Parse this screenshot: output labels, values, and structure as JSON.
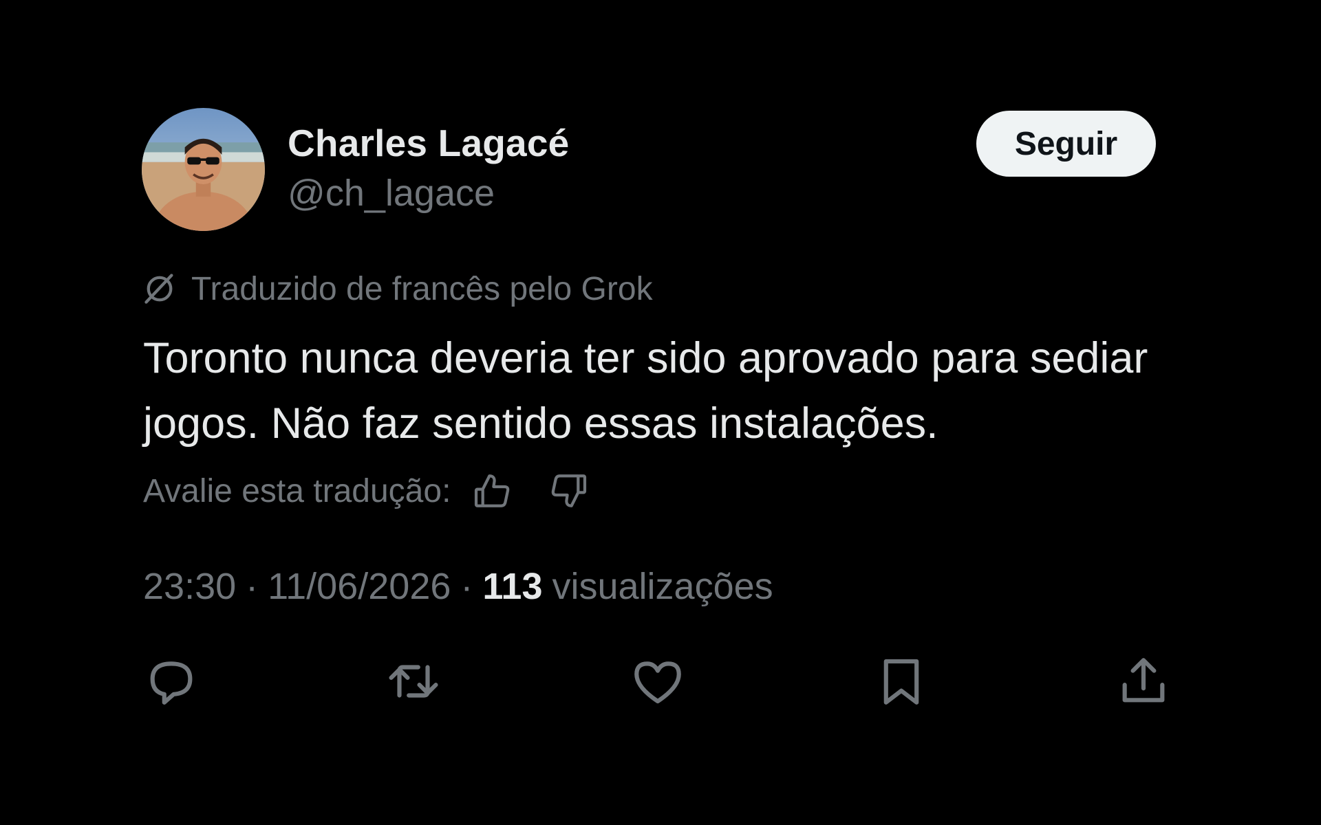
{
  "author": {
    "display_name": "Charles Lagacé",
    "handle": "@ch_lagace",
    "avatar_icon": "profile-photo-beach"
  },
  "follow_button": {
    "label": "Seguir"
  },
  "translation": {
    "icon": "grok-icon",
    "notice": "Traduzido de francês pelo Grok",
    "rate_label": "Avalie esta tradução:"
  },
  "tweet": {
    "text": "Toronto nunca deveria ter sido aprovado para sediar jogos. Não faz sentido essas instalações."
  },
  "meta": {
    "time": "23:30",
    "separator": "·",
    "date": "11/06/2026",
    "views_count": "113",
    "views_label": "visualizações"
  },
  "actions": [
    "reply-icon",
    "retweet-icon",
    "like-icon",
    "bookmark-icon",
    "share-icon"
  ],
  "colors": {
    "background": "#000000",
    "primary_text": "#e7e9ea",
    "secondary_text": "#71767b",
    "follow_button_bg": "#eff3f4"
  }
}
